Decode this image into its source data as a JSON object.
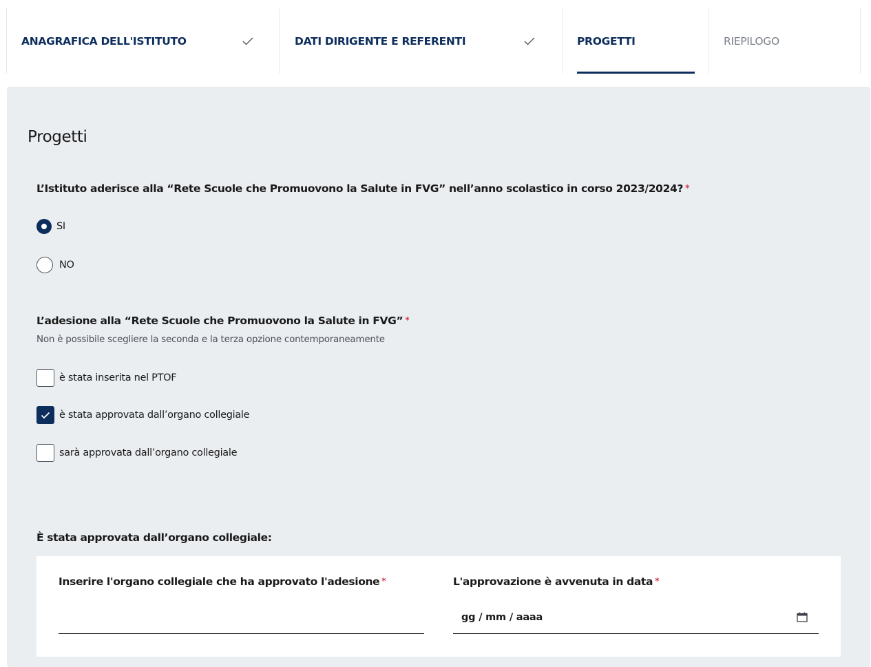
{
  "stepper": {
    "steps": [
      {
        "label": "ANAGRAFICA DELL'ISTITUTO",
        "state": "completed"
      },
      {
        "label": "DATI DIRIGENTE E REFERENTI",
        "state": "completed"
      },
      {
        "label": "PROGETTI",
        "state": "active"
      },
      {
        "label": "RIEPILOGO",
        "state": "inactive"
      }
    ]
  },
  "main": {
    "title": "Progetti",
    "q1": {
      "label": "L’Istituto aderisce alla “Rete Scuole che Promuovono la Salute in FVG” nell’anno scolastico in corso 2023/2024?",
      "required_mark": "*",
      "options": [
        {
          "label": "SI",
          "selected": true
        },
        {
          "label": "NO",
          "selected": false
        }
      ]
    },
    "q2": {
      "label": "L’adesione alla “Rete Scuole che Promuovono la Salute in FVG”",
      "required_mark": "*",
      "hint": "Non è possibile scegliere la seconda e la terza opzione contemporaneamente",
      "options": [
        {
          "label": "è stata inserita nel PTOF",
          "checked": false
        },
        {
          "label": "è stata approvata dall’organo collegiale",
          "checked": true
        },
        {
          "label": "sarà approvata dall’organo collegiale",
          "checked": false
        }
      ]
    },
    "approval": {
      "heading": "È stata approvata dall’organo collegiale:",
      "organ_field": {
        "label": "Inserire l'organo collegiale che ha approvato l'adesione",
        "required_mark": "*",
        "value": ""
      },
      "date_field": {
        "label": "L'approvazione è avvenuta in data",
        "required_mark": "*",
        "value": "gg / mm / aaaa"
      }
    }
  },
  "colors": {
    "primary": "#0d2d5c",
    "required": "#d9364f",
    "panel_bg": "#ebeef1",
    "inactive_text": "#7a8089"
  },
  "icons": {
    "step_complete": "check-icon",
    "date_picker": "calendar-icon"
  }
}
